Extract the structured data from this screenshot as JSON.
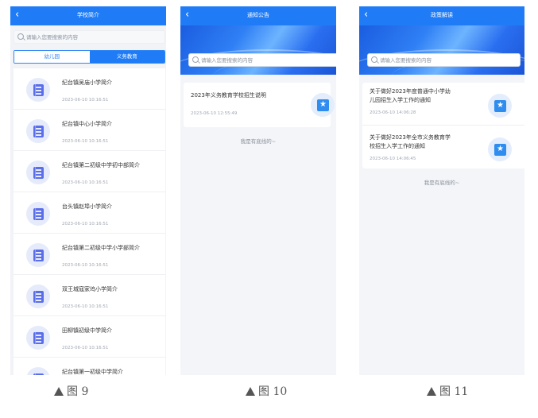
{
  "screen1": {
    "title": "学校简介",
    "back": "‹",
    "search_placeholder": "请输入您要搜索的内容",
    "tabs": [
      "幼儿园",
      "义务教育"
    ],
    "items": [
      {
        "name": "纪台镇吴庙小学简介",
        "date": "2023-06-10 10:16:51"
      },
      {
        "name": "纪台镇中心小学简介",
        "date": "2023-06-10 10:16:51"
      },
      {
        "name": "纪台镇第二初级中学初中部简介",
        "date": "2023-06-10 10:16:51"
      },
      {
        "name": "台头镇赵埠小学简介",
        "date": "2023-06-10 10:16:51"
      },
      {
        "name": "纪台镇第二初级中学小学部简介",
        "date": "2023-06-10 10:16:51"
      },
      {
        "name": "双王城寇家坞小学简介",
        "date": "2023-06-10 10:16:51"
      },
      {
        "name": "田柳镇初级中学简介",
        "date": "2023-06-10 10:16:51"
      },
      {
        "name": "纪台镇第一初级中学简介",
        "date": ""
      }
    ]
  },
  "screen2": {
    "title": "通知公告",
    "back": "‹",
    "search_placeholder": "请输入您要搜索的内容",
    "items": [
      {
        "title": "2023年义务教育学校招生说明",
        "date": "2023-06-10 12:55:49"
      }
    ],
    "footer": "我是有底线的~"
  },
  "screen3": {
    "title": "政策解读",
    "back": "‹",
    "search_placeholder": "请输入您要搜索的内容",
    "items": [
      {
        "title_line1": "关于做好2023年度普通中小学幼",
        "title_line2": "儿园招生入学工作的通知",
        "date": "2023-06-10 14:06:28"
      },
      {
        "title_line1": "关于做好2023年全市义务教育学",
        "title_line2": "校招生入学工作的通知",
        "date": "2023-06-10 14:06:45"
      }
    ],
    "footer": "我是有底线的~"
  },
  "captions": [
    "图 9",
    "图 10",
    "图 11"
  ],
  "colors": {
    "primary": "#1f7cf6",
    "background": "#f3f5f9"
  },
  "icons": {
    "list_item": "book-icon",
    "notice_item": "star-book-icon",
    "search": "search-icon",
    "back": "back-arrow-icon"
  }
}
